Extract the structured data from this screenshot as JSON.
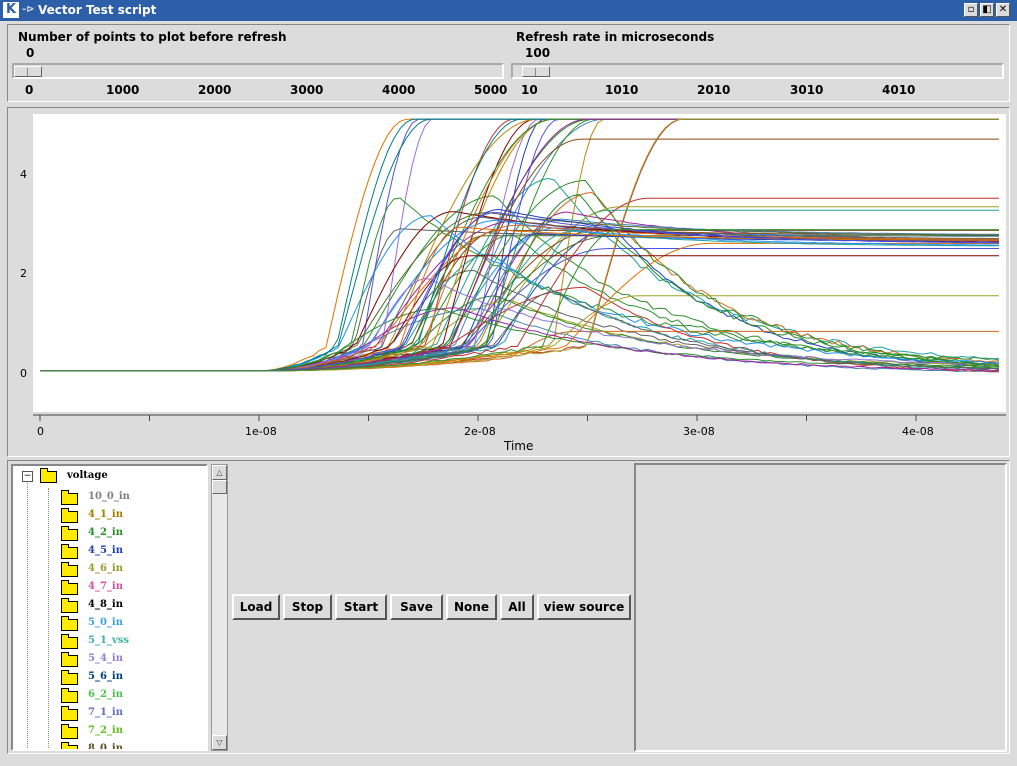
{
  "window": {
    "title": "Vector Test script"
  },
  "controls": {
    "points": {
      "label": "Number of points to plot before refresh",
      "value": "0",
      "value_fraction": 0.0,
      "ticks": [
        "0",
        "1000",
        "2000",
        "3000",
        "4000",
        "5000"
      ]
    },
    "refresh": {
      "label": "Refresh rate in microseconds",
      "value": "100",
      "value_fraction": 0.02,
      "ticks": [
        "10",
        "1010",
        "2010",
        "3010",
        "4010"
      ]
    }
  },
  "chart_data": {
    "type": "line",
    "xlabel": "Time",
    "ylabel": "",
    "xlim": [
      0,
      4.4e-08
    ],
    "ylim": [
      -0.8,
      5.0
    ],
    "x_ticks": [
      "0",
      "1e-08",
      "2e-08",
      "3e-08",
      "4e-08"
    ],
    "y_ticks": [
      "0",
      "2",
      "4"
    ],
    "series_note": "",
    "colors": [
      "#1f3fbf",
      "#2a8f2a",
      "#c03030",
      "#20a0a0",
      "#a020a0",
      "#a0a020",
      "#606060",
      "#e07000",
      "#5050e0",
      "#309030",
      "#8b4513",
      "#1e90ff",
      "#800000",
      "#008080",
      "#9370db",
      "#b8860b",
      "#228b22",
      "#4682b4",
      "#d2691e",
      "#556b2f"
    ]
  },
  "tree": {
    "root": "voltage",
    "items": [
      {
        "label": "10_0_in",
        "color": "#808080"
      },
      {
        "label": "4_1_in",
        "color": "#a08000"
      },
      {
        "label": "4_2_in",
        "color": "#2a8f2a"
      },
      {
        "label": "4_5_in",
        "color": "#1f3fbf"
      },
      {
        "label": "4_6_in",
        "color": "#9a9a30"
      },
      {
        "label": "4_7_in",
        "color": "#d050a0"
      },
      {
        "label": "4_8_in",
        "color": "#000000"
      },
      {
        "label": "5_0_in",
        "color": "#40a0e0"
      },
      {
        "label": "5_1_vss",
        "color": "#40b0a0"
      },
      {
        "label": "5_4_in",
        "color": "#9080d0"
      },
      {
        "label": "5_6_in",
        "color": "#004080"
      },
      {
        "label": "6_2_in",
        "color": "#50c050"
      },
      {
        "label": "7_1_in",
        "color": "#6070c0"
      },
      {
        "label": "7_2_in",
        "color": "#60c020"
      },
      {
        "label": "8_0_in",
        "color": "#505020"
      }
    ]
  },
  "buttons": {
    "load": "Load",
    "stop": "Stop",
    "start": "Start",
    "save": "Save",
    "none": "None",
    "all": "All",
    "view_source": "view source"
  }
}
